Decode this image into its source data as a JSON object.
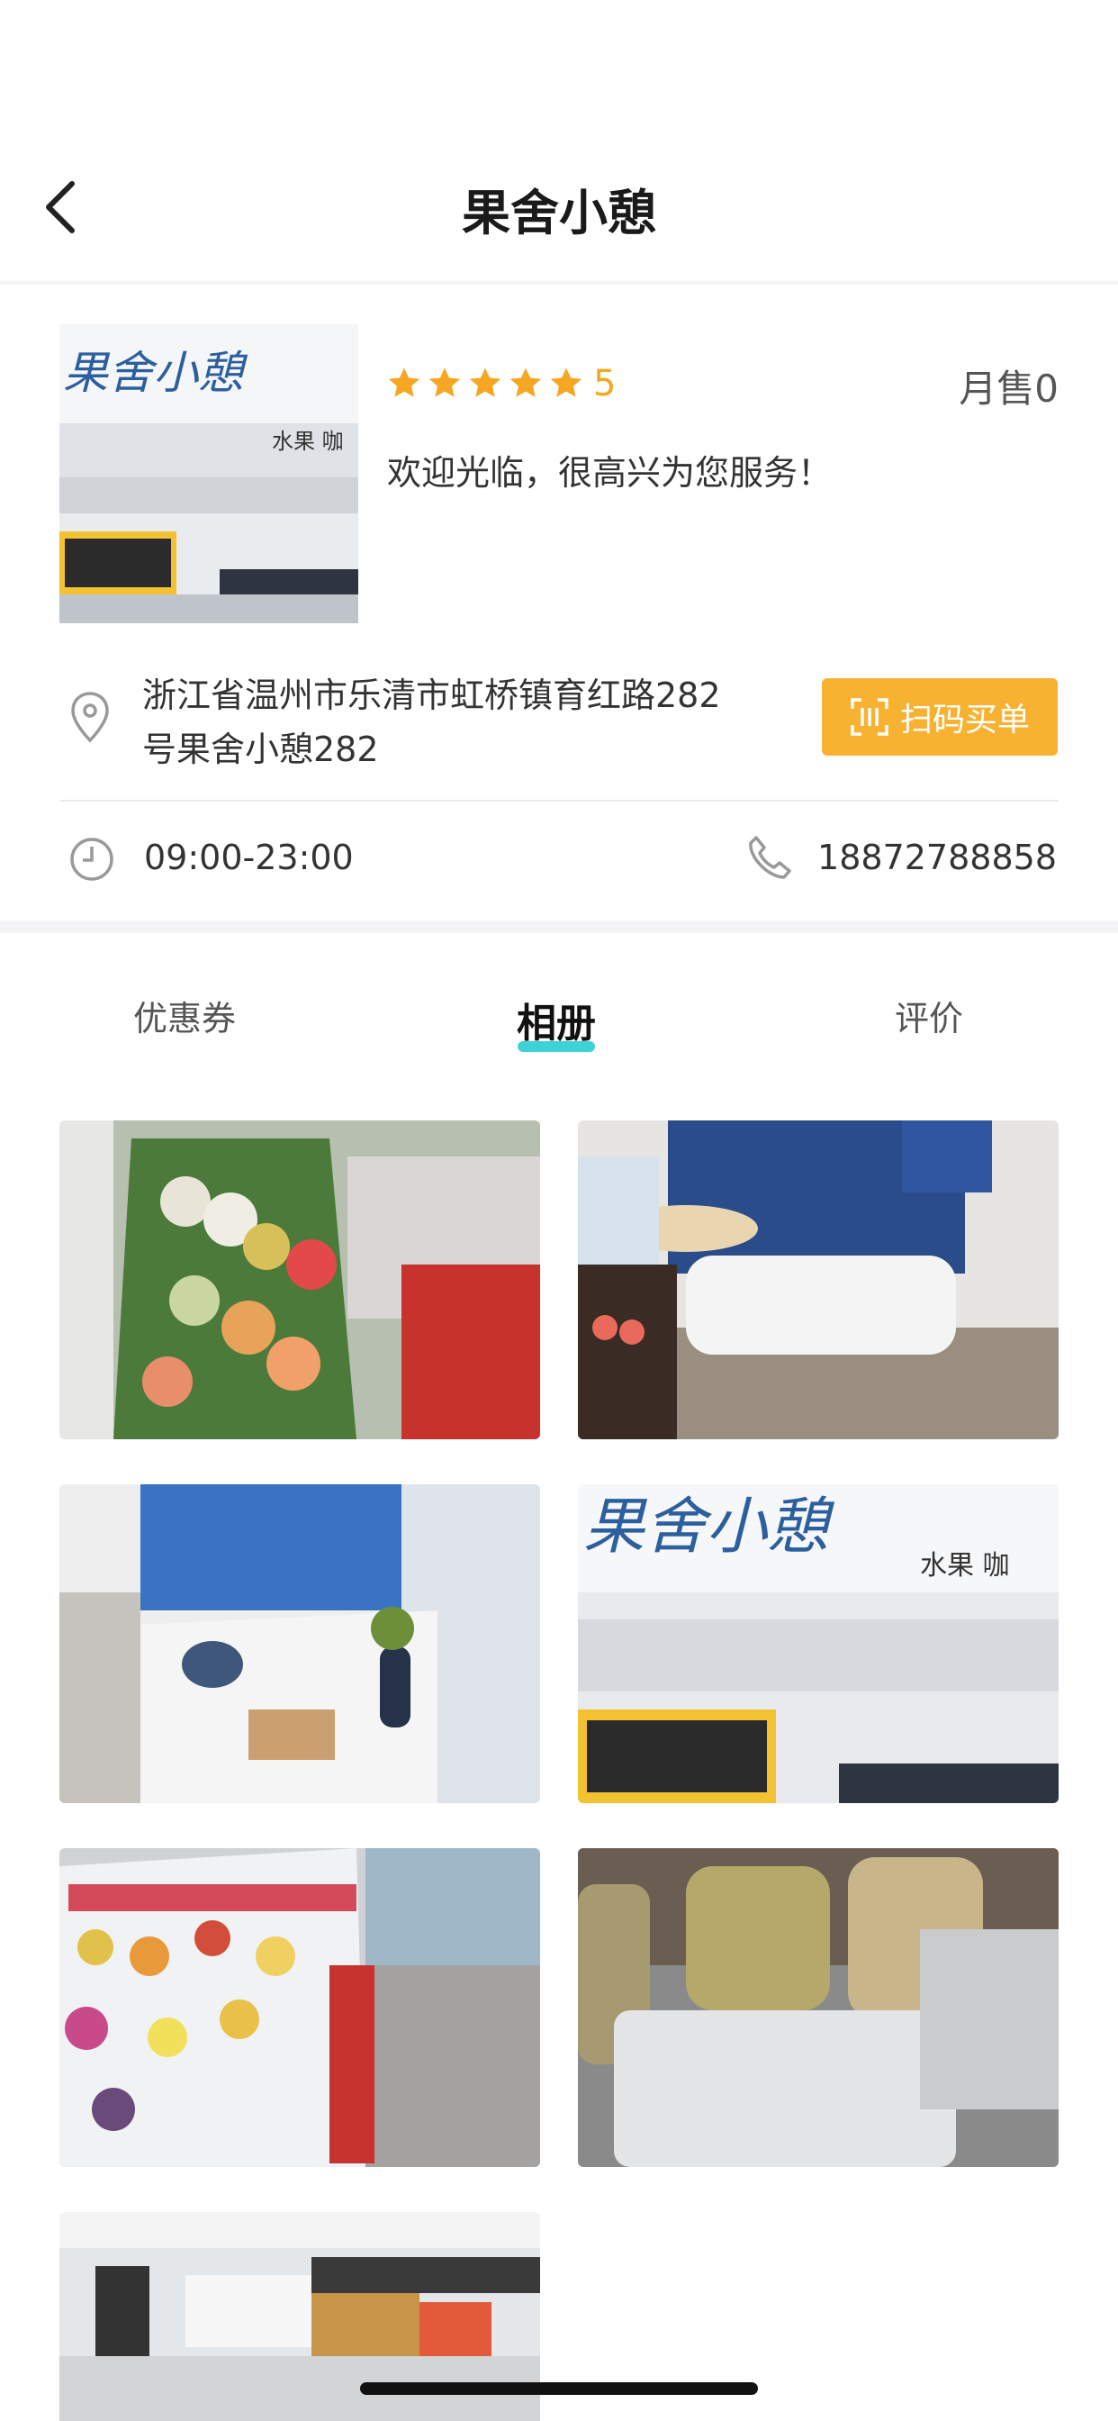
{
  "nav": {
    "title": "果舍小憩",
    "back_icon": "chevron-left-icon"
  },
  "store": {
    "rating_text": "5",
    "stars": 5,
    "monthly_sales": "月售0",
    "welcome": "欢迎光临，很高兴为您服务！",
    "address_line1": "浙江省温州市乐清市虹桥镇育红路282",
    "address_line2": "号果舍小憩282",
    "scan_button": "扫码买单",
    "hours": "09:00-23:00",
    "phone": "18872788858",
    "logo_text": "果舍小憩",
    "sign_text": "水果 咖",
    "icons": [
      "location-pin-icon",
      "scan-icon",
      "clock-icon",
      "phone-icon",
      "star-icon"
    ]
  },
  "tabs": [
    {
      "label": "优惠券",
      "active": false
    },
    {
      "label": "相册",
      "active": true
    },
    {
      "label": "评价",
      "active": false
    }
  ],
  "album_photo_count": 7,
  "colors": {
    "accent": "#f8b232",
    "star": "#f5a623",
    "tab_indicator": "#3cd3d6"
  }
}
